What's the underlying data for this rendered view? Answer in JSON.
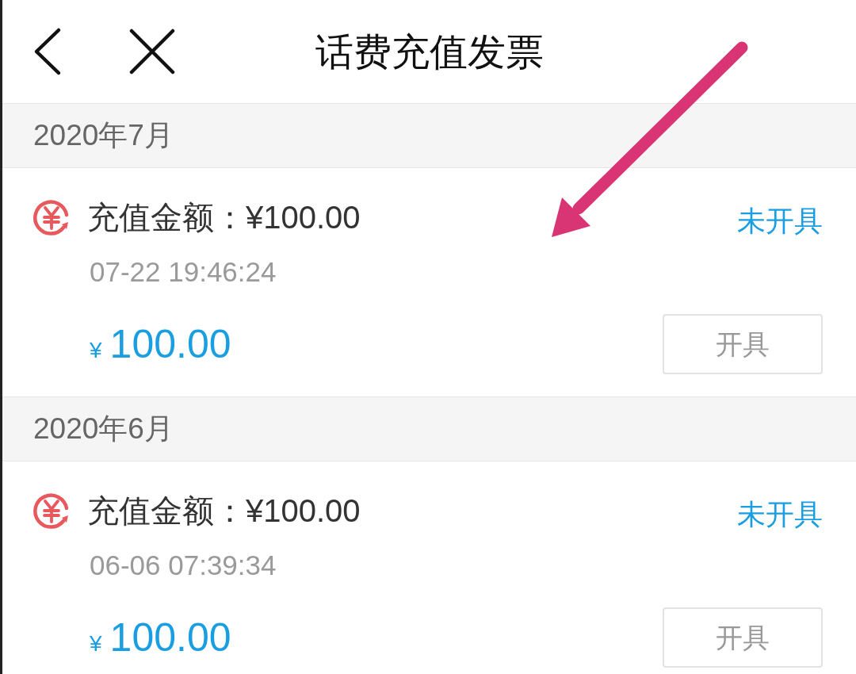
{
  "header": {
    "title": "话费充值发票"
  },
  "sections": [
    {
      "month": "2020年7月",
      "records": [
        {
          "label": "充值金额：¥100.00",
          "time": "07-22 19:46:24",
          "status": "未开具",
          "currency": "¥",
          "amount": "100.00",
          "action": "开具"
        }
      ]
    },
    {
      "month": "2020年6月",
      "records": [
        {
          "label": "充值金额：¥100.00",
          "time": "06-06 07:39:34",
          "status": "未开具",
          "currency": "¥",
          "amount": "100.00",
          "action": "开具"
        }
      ]
    }
  ]
}
